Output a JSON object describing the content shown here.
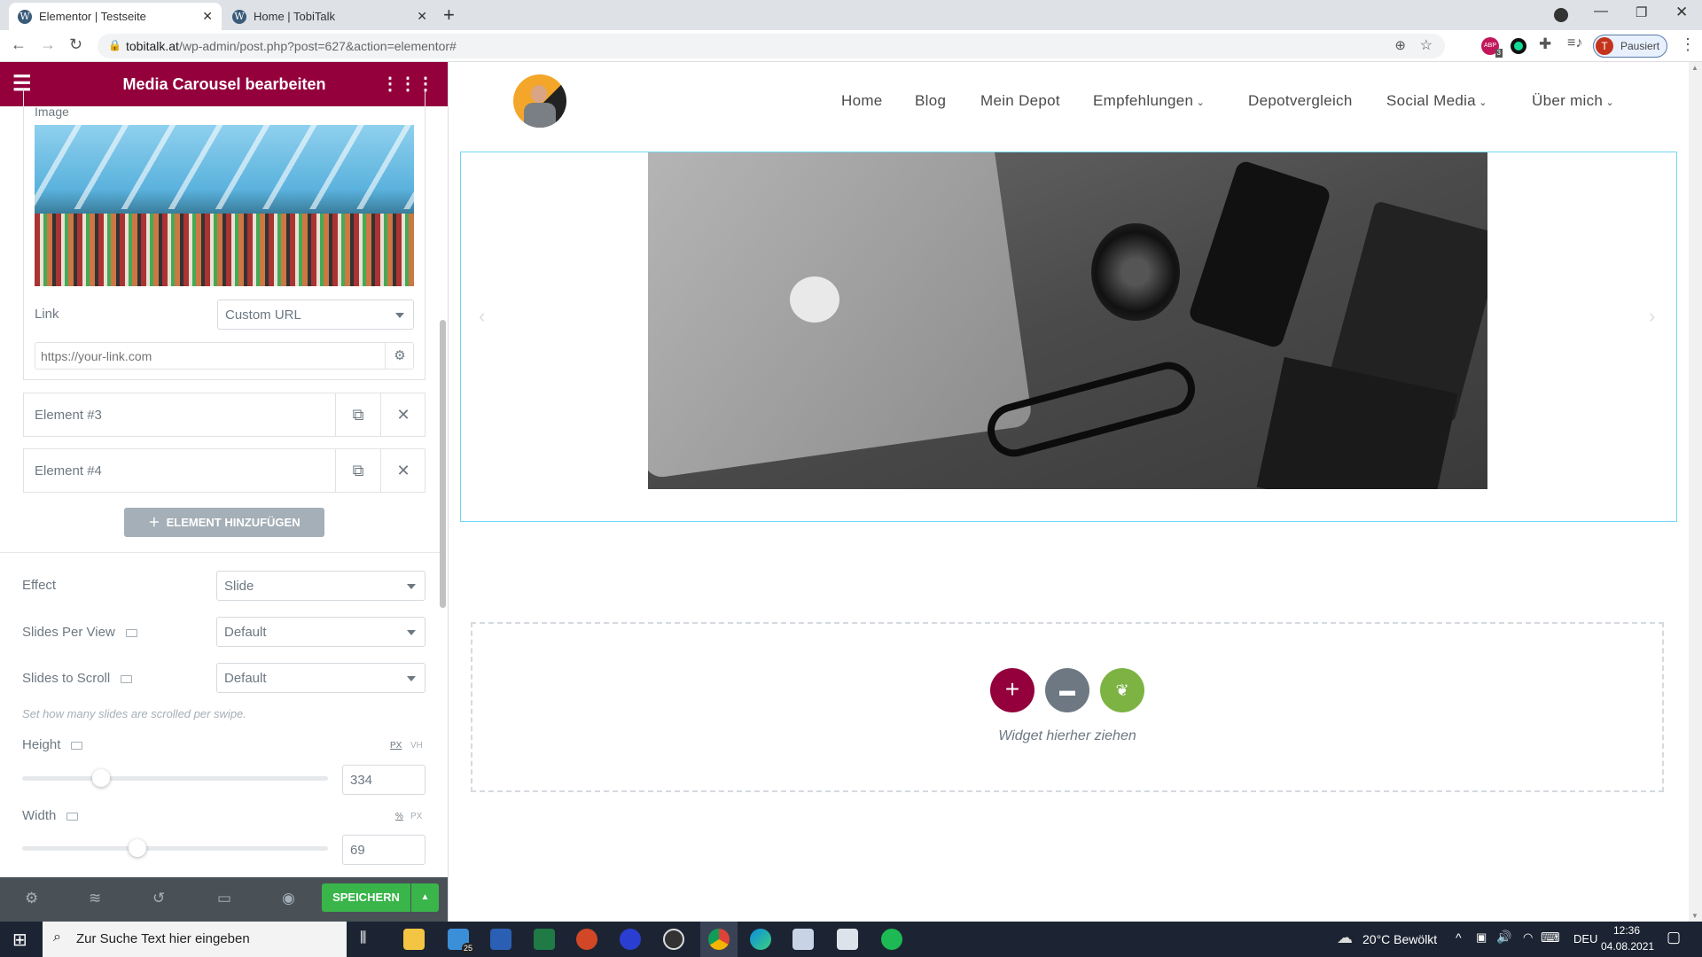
{
  "browser": {
    "tabs": [
      {
        "title": "Elementor | Testseite",
        "active": true
      },
      {
        "title": "Home | TobiTalk",
        "active": false
      }
    ],
    "url_domain": "tobitalk.at",
    "url_path": "/wp-admin/post.php?post=627&action=elementor#",
    "profile_initial": "T",
    "profile_status": "Pausiert",
    "extension_badge": "3"
  },
  "panel": {
    "title": "Media Carousel bearbeiten",
    "image_label": "Image",
    "link_label": "Link",
    "link_select": "Custom URL",
    "link_placeholder": "https://your-link.com",
    "items": [
      {
        "label": "Element #3"
      },
      {
        "label": "Element #4"
      }
    ],
    "add_button": "ELEMENT HINZUFÜGEN",
    "effect_label": "Effect",
    "effect_value": "Slide",
    "spv_label": "Slides Per View",
    "spv_value": "Default",
    "sts_label": "Slides to Scroll",
    "sts_value": "Default",
    "sts_help": "Set how many slides are scrolled per swipe.",
    "height_label": "Height",
    "height_units": [
      "PX",
      "VH"
    ],
    "height_value": "334",
    "width_label": "Width",
    "width_units": [
      "%",
      "PX"
    ],
    "width_value": "69",
    "save_button": "SPEICHERN"
  },
  "site": {
    "nav": [
      "Home",
      "Blog",
      "Mein Depot",
      "Empfehlungen",
      "Depotvergleich",
      "Social Media",
      "Über mich"
    ],
    "dropzone_text": "Widget hierher ziehen"
  },
  "colors": {
    "elementor_brand": "#93003c",
    "save_green": "#39b54a",
    "add_circle": "#93003c",
    "folder_circle": "#6d7882",
    "leaf_circle": "#7cb342"
  },
  "taskbar": {
    "search_placeholder": "Zur Suche Text hier eingeben",
    "weather": "20°C  Bewölkt",
    "lang": "DEU",
    "time": "12:36",
    "date": "04.08.2021",
    "mail_badge": "25"
  }
}
